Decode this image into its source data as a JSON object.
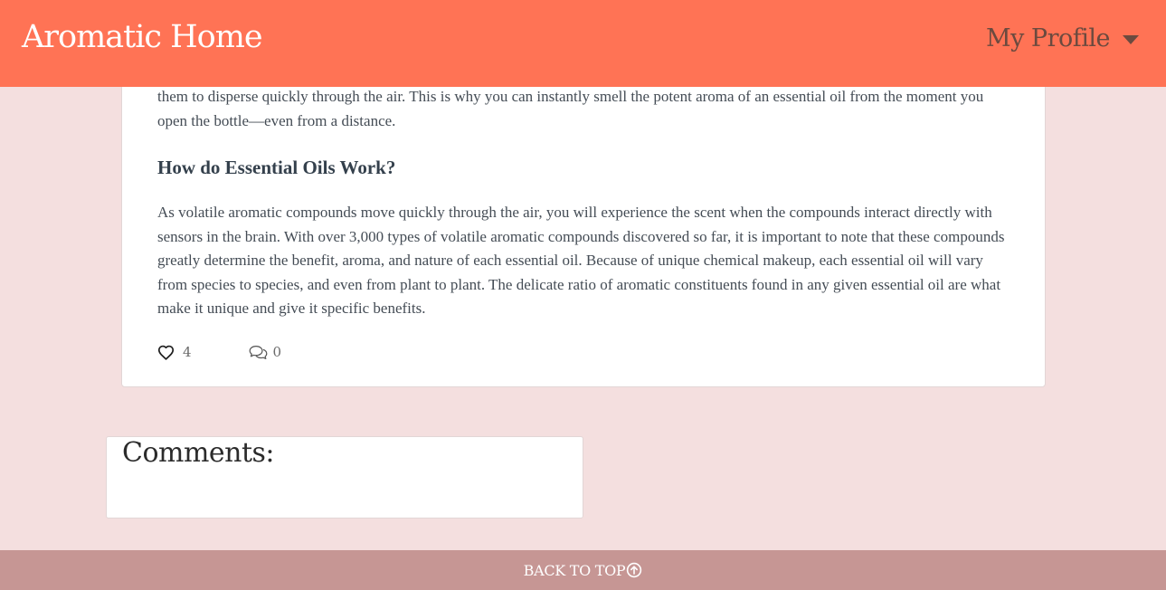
{
  "header": {
    "brand": "Aromatic Home",
    "profile_label": "My Profile",
    "profile_icon": "caret-down-icon"
  },
  "article": {
    "intro_fragment": "them to disperse quickly through the air. This is why you can instantly smell the potent aroma of an essential oil from the moment you open the bottle—even from a distance.",
    "section_heading": "How do Essential Oils Work?",
    "body": "As volatile aromatic compounds move quickly through the air, you will experience the scent when the compounds interact directly with sensors in the brain. With over 3,000 types of volatile aromatic compounds discovered so far, it is important to note that these compounds greatly determine the benefit, aroma, and nature of each essential oil. Because of unique chemical makeup, each essential oil will vary from species to species, and even from plant to plant. The delicate ratio of aromatic constituents found in any given essential oil are what make it unique and give it specific benefits.",
    "likes": "4",
    "like_icon": "heart-icon",
    "comments_count": "0",
    "comments_icon": "comments-icon"
  },
  "comments_section": {
    "title": "Comments:"
  },
  "footer": {
    "back_to_top": "BACK TO TOP",
    "back_to_top_icon": "arrow-up-circle-icon"
  },
  "colors": {
    "navbar": "#ff7355",
    "page_background": "#f4dfdf",
    "footer": "#c69694"
  }
}
